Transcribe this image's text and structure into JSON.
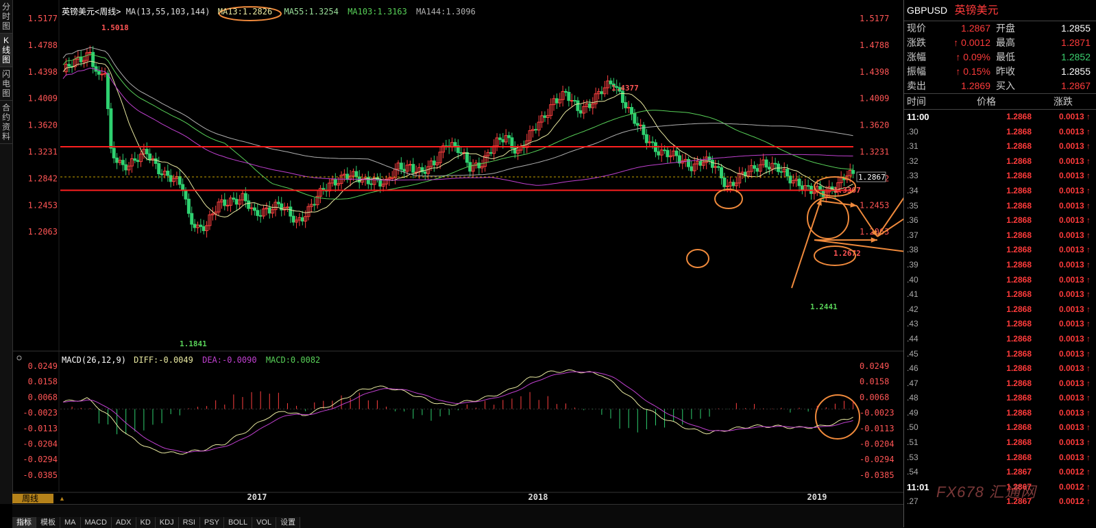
{
  "left_tabs": [
    "分时图",
    "K线图",
    "闪电图",
    "合约资料"
  ],
  "active_left_tab": 1,
  "legend": {
    "title": "英镑美元<周线>",
    "ma_prefix": "MA(13,55,103,144)",
    "ma13": "MA13:1.2826",
    "ma55": "MA55:1.3254",
    "ma103": "MA103:1.3163",
    "ma144": "MA144:1.3096",
    "macd_prefix": "MACD(26,12,9)",
    "diff": "DIFF:-0.0049",
    "dea": "DEA:-0.0090",
    "macd": "MACD:0.0082"
  },
  "colors": {
    "up": "#ff4040",
    "down": "#2fd170",
    "ma13": "#e9e9a0",
    "ma55": "#58d158",
    "ma103": "#b0b0b0",
    "ma144": "#c040d0",
    "hline": "#ff2020",
    "annot": "#f08a3c",
    "diff": "#e9e9a0",
    "dea": "#c040d0"
  },
  "price_ticks": [
    "1.5177",
    "1.4788",
    "1.4398",
    "1.4009",
    "1.3620",
    "1.3231",
    "1.2842",
    "1.2453",
    "1.2063"
  ],
  "macd_ticks": [
    "0.0249",
    "0.0158",
    "0.0068",
    "-0.0023",
    "-0.0113",
    "-0.0204",
    "-0.0294",
    "-0.0385"
  ],
  "x_labels": [
    "2017",
    "2018",
    "2019"
  ],
  "price_annotations": {
    "high1": "1.5018",
    "low1": "1.1841",
    "high2": "1.4377",
    "low2": "1.2441",
    "resistance": "1.3307",
    "support": "1.2672",
    "current": "1.2867"
  },
  "chart_data": {
    "type": "candlestick",
    "title": "英镑美元<周线>",
    "price_range": [
      1.17,
      1.52
    ],
    "support_level": 1.2672,
    "resistance_level": 1.3307,
    "current_price": 1.2867,
    "approx_weekly_closes_start": 1.44,
    "ma_values": {
      "MA13": 1.2826,
      "MA55": 1.3254,
      "MA103": 1.3163,
      "MA144": 1.3096
    },
    "macd": {
      "DIFF": -0.0049,
      "DEA": -0.009,
      "MACD": 0.0082
    },
    "macd_range": [
      -0.0385,
      0.0249
    ]
  },
  "bottom_tabs": [
    "指标",
    "模板",
    "MA",
    "MACD",
    "ADX",
    "KD",
    "KDJ",
    "RSI",
    "PSY",
    "BOLL",
    "VOL",
    "设置"
  ],
  "period_label": "周线",
  "quote": {
    "code": "GBPUSD",
    "name": "英镑美元",
    "rows": [
      {
        "l1": "现价",
        "v1": "1.2867",
        "c1": "red",
        "l2": "开盘",
        "v2": "1.2855",
        "c2": "white"
      },
      {
        "l1": "涨跌",
        "v1": "0.0012",
        "c1": "red",
        "arrow1": "up",
        "l2": "最高",
        "v2": "1.2871",
        "c2": "red"
      },
      {
        "l1": "涨幅",
        "v1": "0.09%",
        "c1": "red",
        "arrow1": "up",
        "l2": "最低",
        "v2": "1.2852",
        "c2": "green"
      },
      {
        "l1": "振幅",
        "v1": "0.15%",
        "c1": "red",
        "arrow1": "up",
        "l2": "昨收",
        "v2": "1.2855",
        "c2": "white"
      },
      {
        "l1": "卖出",
        "v1": "1.2869",
        "c1": "red",
        "l2": "买入",
        "v2": "1.2867",
        "c2": "red"
      }
    ],
    "header": {
      "time": "时间",
      "price": "价格",
      "change": "涨跌"
    },
    "ticks": [
      {
        "t": "11:00",
        "p": "1.2868",
        "c": "0.0013"
      },
      {
        "t": ".30",
        "p": "1.2868",
        "c": "0.0013"
      },
      {
        "t": ".31",
        "p": "1.2868",
        "c": "0.0013"
      },
      {
        "t": ".32",
        "p": "1.2868",
        "c": "0.0013"
      },
      {
        "t": ".33",
        "p": "1.2868",
        "c": "0.0013"
      },
      {
        "t": ".34",
        "p": "1.2868",
        "c": "0.0013"
      },
      {
        "t": ".35",
        "p": "1.2868",
        "c": "0.0013"
      },
      {
        "t": ".36",
        "p": "1.2868",
        "c": "0.0013"
      },
      {
        "t": ".37",
        "p": "1.2868",
        "c": "0.0013"
      },
      {
        "t": ".38",
        "p": "1.2868",
        "c": "0.0013"
      },
      {
        "t": ".39",
        "p": "1.2868",
        "c": "0.0013"
      },
      {
        "t": ".40",
        "p": "1.2868",
        "c": "0.0013"
      },
      {
        "t": ".41",
        "p": "1.2868",
        "c": "0.0013"
      },
      {
        "t": ".42",
        "p": "1.2868",
        "c": "0.0013"
      },
      {
        "t": ".43",
        "p": "1.2868",
        "c": "0.0013"
      },
      {
        "t": ".44",
        "p": "1.2868",
        "c": "0.0013"
      },
      {
        "t": ".45",
        "p": "1.2868",
        "c": "0.0013"
      },
      {
        "t": ".46",
        "p": "1.2868",
        "c": "0.0013"
      },
      {
        "t": ".47",
        "p": "1.2868",
        "c": "0.0013"
      },
      {
        "t": ".48",
        "p": "1.2868",
        "c": "0.0013"
      },
      {
        "t": ".49",
        "p": "1.2868",
        "c": "0.0013"
      },
      {
        "t": ".50",
        "p": "1.2868",
        "c": "0.0013"
      },
      {
        "t": ".51",
        "p": "1.2868",
        "c": "0.0013"
      },
      {
        "t": ".53",
        "p": "1.2868",
        "c": "0.0013"
      },
      {
        "t": ".54",
        "p": "1.2867",
        "c": "0.0012"
      },
      {
        "t": "11:01",
        "p": "1.2867",
        "c": "0.0012"
      },
      {
        "t": ".27",
        "p": "1.2867",
        "c": "0.0012"
      }
    ]
  },
  "watermark": "FX678 汇通网"
}
